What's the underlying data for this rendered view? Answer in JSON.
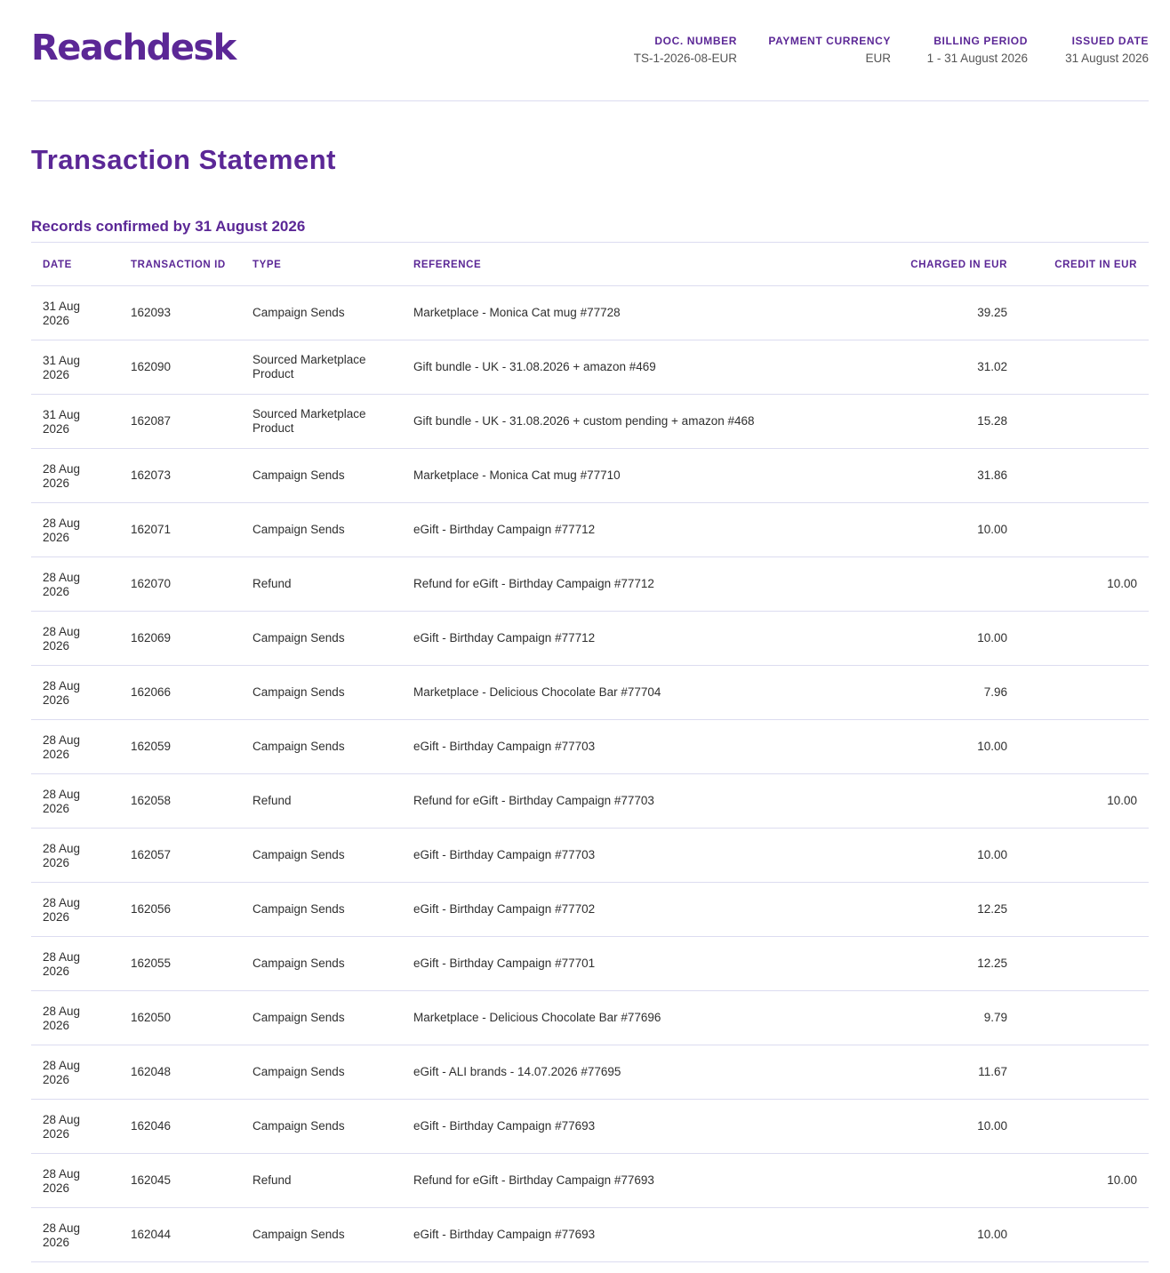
{
  "brand": {
    "name": "Reachdesk",
    "accent": "#5b2796"
  },
  "header": {
    "meta": [
      {
        "label": "DOC. NUMBER",
        "value": "TS-1-2026-08-EUR"
      },
      {
        "label": "PAYMENT CURRENCY",
        "value": "EUR"
      },
      {
        "label": "BILLING PERIOD",
        "value": "1 - 31 August 2026"
      },
      {
        "label": "ISSUED DATE",
        "value": "31 August 2026"
      }
    ]
  },
  "title": "Transaction Statement",
  "subtitle": "Records confirmed by 31 August 2026",
  "table": {
    "headers": {
      "date": "DATE",
      "id": "TRANSACTION ID",
      "type": "TYPE",
      "reference": "REFERENCE",
      "charged": "CHARGED IN EUR",
      "credit": "CREDIT IN EUR"
    },
    "rows": [
      {
        "date": "31 Aug 2026",
        "id": "162093",
        "type": "Campaign Sends",
        "reference": "Marketplace - Monica Cat mug #77728",
        "charged": "39.25",
        "credit": ""
      },
      {
        "date": "31 Aug 2026",
        "id": "162090",
        "type": "Sourced Marketplace Product",
        "reference": "Gift bundle - UK - 31.08.2026 + amazon #469",
        "charged": "31.02",
        "credit": ""
      },
      {
        "date": "31 Aug 2026",
        "id": "162087",
        "type": "Sourced Marketplace Product",
        "reference": "Gift bundle - UK - 31.08.2026 + custom pending + amazon #468",
        "charged": "15.28",
        "credit": ""
      },
      {
        "date": "28 Aug 2026",
        "id": "162073",
        "type": "Campaign Sends",
        "reference": "Marketplace - Monica Cat mug #77710",
        "charged": "31.86",
        "credit": ""
      },
      {
        "date": "28 Aug 2026",
        "id": "162071",
        "type": "Campaign Sends",
        "reference": "eGift - Birthday Campaign #77712",
        "charged": "10.00",
        "credit": ""
      },
      {
        "date": "28 Aug 2026",
        "id": "162070",
        "type": "Refund",
        "reference": "Refund for eGift - Birthday Campaign #77712",
        "charged": "",
        "credit": "10.00"
      },
      {
        "date": "28 Aug 2026",
        "id": "162069",
        "type": "Campaign Sends",
        "reference": "eGift - Birthday Campaign #77712",
        "charged": "10.00",
        "credit": ""
      },
      {
        "date": "28 Aug 2026",
        "id": "162066",
        "type": "Campaign Sends",
        "reference": "Marketplace - Delicious Chocolate Bar #77704",
        "charged": "7.96",
        "credit": ""
      },
      {
        "date": "28 Aug 2026",
        "id": "162059",
        "type": "Campaign Sends",
        "reference": "eGift - Birthday Campaign #77703",
        "charged": "10.00",
        "credit": ""
      },
      {
        "date": "28 Aug 2026",
        "id": "162058",
        "type": "Refund",
        "reference": "Refund for eGift - Birthday Campaign #77703",
        "charged": "",
        "credit": "10.00"
      },
      {
        "date": "28 Aug 2026",
        "id": "162057",
        "type": "Campaign Sends",
        "reference": "eGift - Birthday Campaign #77703",
        "charged": "10.00",
        "credit": ""
      },
      {
        "date": "28 Aug 2026",
        "id": "162056",
        "type": "Campaign Sends",
        "reference": "eGift - Birthday Campaign #77702",
        "charged": "12.25",
        "credit": ""
      },
      {
        "date": "28 Aug 2026",
        "id": "162055",
        "type": "Campaign Sends",
        "reference": "eGift - Birthday Campaign #77701",
        "charged": "12.25",
        "credit": ""
      },
      {
        "date": "28 Aug 2026",
        "id": "162050",
        "type": "Campaign Sends",
        "reference": "Marketplace - Delicious Chocolate Bar #77696",
        "charged": "9.79",
        "credit": ""
      },
      {
        "date": "28 Aug 2026",
        "id": "162048",
        "type": "Campaign Sends",
        "reference": "eGift - ALI brands - 14.07.2026 #77695",
        "charged": "11.67",
        "credit": ""
      },
      {
        "date": "28 Aug 2026",
        "id": "162046",
        "type": "Campaign Sends",
        "reference": "eGift - Birthday Campaign #77693",
        "charged": "10.00",
        "credit": ""
      },
      {
        "date": "28 Aug 2026",
        "id": "162045",
        "type": "Refund",
        "reference": "Refund for eGift - Birthday Campaign #77693",
        "charged": "",
        "credit": "10.00"
      },
      {
        "date": "28 Aug 2026",
        "id": "162044",
        "type": "Campaign Sends",
        "reference": "eGift - Birthday Campaign #77693",
        "charged": "10.00",
        "credit": ""
      }
    ]
  }
}
